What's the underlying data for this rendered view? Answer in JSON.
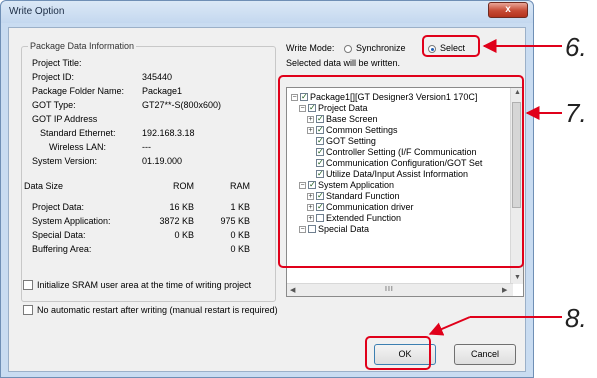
{
  "window": {
    "title": "Write Option",
    "close_label": "x"
  },
  "package_info": {
    "group_title": "Package Data Information",
    "rows": [
      {
        "label": "Project Title:",
        "value": ""
      },
      {
        "label": "Project ID:",
        "value": "345440"
      },
      {
        "label": "Package Folder Name:",
        "value": "Package1"
      },
      {
        "label": "GOT Type:",
        "value": "GT27**-S(800x600)"
      },
      {
        "label": "GOT IP Address",
        "value": ""
      },
      {
        "label": "Standard Ethernet:",
        "value": "192.168.3.18"
      },
      {
        "label": "Wireless LAN:",
        "value": "---"
      },
      {
        "label": "System Version:",
        "value": "01.19.000"
      }
    ],
    "data_size": {
      "header": "Data Size",
      "col_rom": "ROM",
      "col_ram": "RAM",
      "rows": [
        {
          "label": "Project Data:",
          "rom": "16 KB",
          "ram": "1 KB"
        },
        {
          "label": "System Application:",
          "rom": "3872 KB",
          "ram": "975 KB"
        },
        {
          "label": "Special Data:",
          "rom": "0 KB",
          "ram": "0 KB"
        },
        {
          "label": "Buffering Area:",
          "rom": "",
          "ram": "0 KB"
        }
      ]
    }
  },
  "write_mode": {
    "label": "Write Mode:",
    "options": [
      "Synchronize",
      "Select"
    ],
    "selected": "Select",
    "hint": "Selected data will be written."
  },
  "tree": {
    "nodes": [
      {
        "label": "Package1[][GT Designer3 Version1 170C]",
        "expander": "−",
        "checked": true
      },
      {
        "label": "Project Data",
        "expander": "−",
        "checked": true
      },
      {
        "label": "Base Screen",
        "expander": "+",
        "checked": true
      },
      {
        "label": "Common Settings",
        "expander": "+",
        "checked": true
      },
      {
        "label": "GOT Setting",
        "expander": "",
        "checked": true
      },
      {
        "label": "Controller Setting (I/F Communication",
        "expander": "",
        "checked": true
      },
      {
        "label": "Communication Configuration/GOT Set",
        "expander": "",
        "checked": true
      },
      {
        "label": "Utilize Data/Input Assist Information",
        "expander": "",
        "checked": true
      },
      {
        "label": "System Application",
        "expander": "−",
        "checked": true
      },
      {
        "label": "Standard Function",
        "expander": "+",
        "checked": true
      },
      {
        "label": "Communication driver",
        "expander": "+",
        "checked": true
      },
      {
        "label": "Extended Function",
        "expander": "+",
        "checked": false
      },
      {
        "label": "Special Data",
        "expander": "−",
        "checked": false
      }
    ],
    "hscroll_thumb_glyph": "III"
  },
  "options": {
    "initialize_sram": "Initialize SRAM user area at the time of writing project",
    "no_auto_restart": "No automatic restart after writing (manual restart is required)"
  },
  "buttons": {
    "ok": "OK",
    "cancel": "Cancel"
  },
  "annotations": {
    "step_6": "6.",
    "step_7": "7.",
    "step_8": "8."
  },
  "colors": {
    "highlight": "#e0001a",
    "window_frame": "#c9dcf1",
    "close_button": "#c64a34"
  }
}
